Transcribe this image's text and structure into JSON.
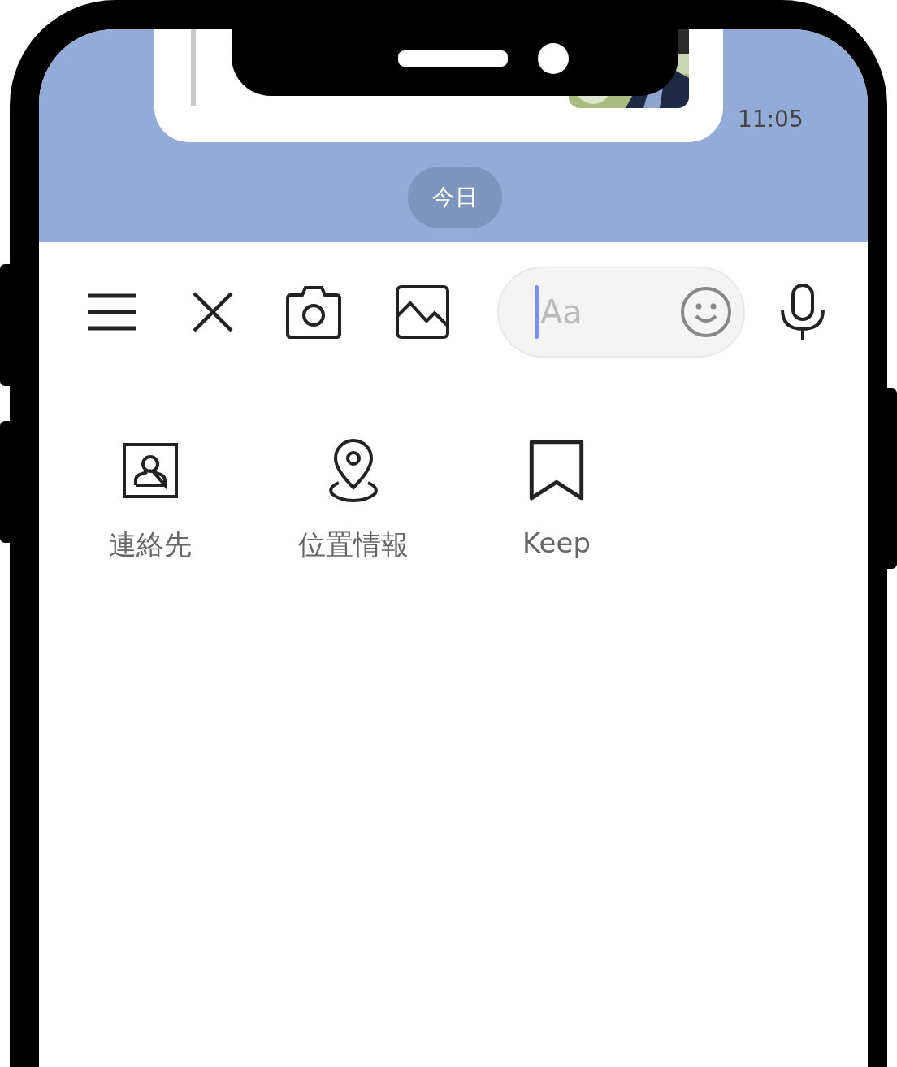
{
  "chat": {
    "time": "11:05",
    "date_divider": "今日"
  },
  "input_bar": {
    "placeholder": "Aa"
  },
  "attachments": [
    {
      "label": "連絡先",
      "kind": "contact"
    },
    {
      "label": "位置情報",
      "kind": "location"
    },
    {
      "label": "Keep",
      "kind": "keep"
    }
  ]
}
